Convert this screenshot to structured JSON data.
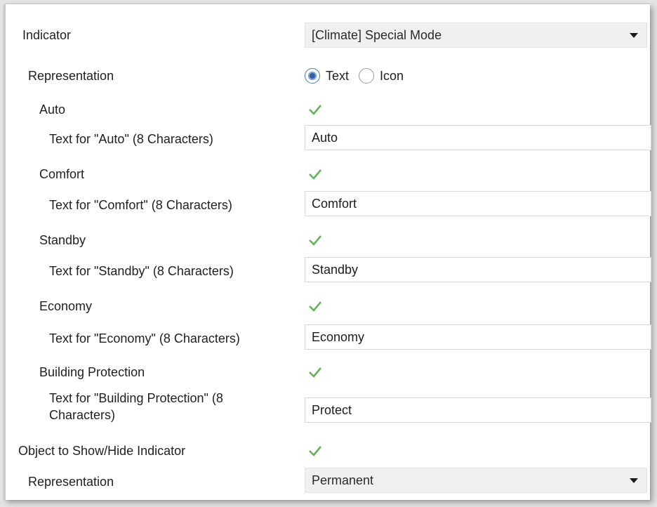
{
  "indicator": {
    "label": "Indicator",
    "value": "[Climate] Special Mode"
  },
  "representation": {
    "label": "Representation",
    "options": [
      "Text",
      "Icon"
    ],
    "selected": "Text"
  },
  "modes": [
    {
      "label": "Auto",
      "checked": true,
      "text_label": "Text for \"Auto\" (8 Characters)",
      "text_value": "Auto"
    },
    {
      "label": "Comfort",
      "checked": true,
      "text_label": "Text for \"Comfort\" (8 Characters)",
      "text_value": "Comfort"
    },
    {
      "label": "Standby",
      "checked": true,
      "text_label": "Text for \"Standby\" (8 Characters)",
      "text_value": "Standby"
    },
    {
      "label": "Economy",
      "checked": true,
      "text_label": "Text for \"Economy\" (8 Characters)",
      "text_value": "Economy"
    },
    {
      "label": "Building Protection",
      "checked": true,
      "text_label_line1": "Text for \"Building Protection\" (8",
      "text_label_line2": "Characters)",
      "text_value": "Protect"
    }
  ],
  "show_hide": {
    "label": "Object to Show/Hide Indicator",
    "checked": true
  },
  "representation2": {
    "label": "Representation",
    "value": "Permanent"
  },
  "colors": {
    "check": "#66b25c",
    "radio_selected": "#2f5fa8",
    "dropdown_bg": "#f0f0f0"
  },
  "icons": {
    "check": "check-icon",
    "dropdown": "chevron-down-icon"
  }
}
